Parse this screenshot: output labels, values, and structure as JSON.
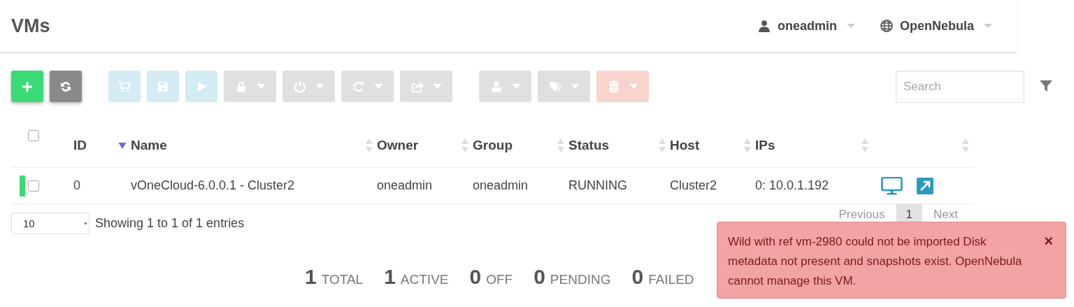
{
  "header": {
    "title": "VMs",
    "user": "oneadmin",
    "zone": "OpenNebula"
  },
  "toolbar": [
    {
      "kind": "create",
      "disabled": false,
      "dropdown": false
    },
    {
      "kind": "refresh",
      "disabled": false,
      "dropdown": false
    },
    {
      "kind": "info",
      "disabled": true,
      "dropdown": false
    },
    {
      "kind": "info",
      "disabled": true,
      "dropdown": false
    },
    {
      "kind": "info",
      "disabled": true,
      "dropdown": false
    },
    {
      "kind": "neutral",
      "disabled": true,
      "dropdown": true
    },
    {
      "kind": "neutral",
      "disabled": true,
      "dropdown": true
    },
    {
      "kind": "neutral",
      "disabled": true,
      "dropdown": true
    },
    {
      "kind": "neutral",
      "disabled": true,
      "dropdown": true
    },
    {
      "kind": "neutral",
      "disabled": true,
      "dropdown": true
    },
    {
      "kind": "neutral",
      "disabled": true,
      "dropdown": true
    },
    {
      "kind": "danger",
      "disabled": true,
      "dropdown": true
    }
  ],
  "search": {
    "placeholder": "Search"
  },
  "table": {
    "select_all": {
      "checked": false
    },
    "columns": [
      {
        "label": "ID",
        "sorted": true
      },
      {
        "label": "Name",
        "sorted": false
      },
      {
        "label": "Owner",
        "sorted": false
      },
      {
        "label": "Group",
        "sorted": false
      },
      {
        "label": "Status",
        "sorted": false
      },
      {
        "label": "Host",
        "sorted": false
      },
      {
        "label": "IPs",
        "sorted": false
      },
      {
        "sorted": false
      }
    ],
    "rows": [
      {
        "color": "#3adb76",
        "checked": false,
        "id": "0",
        "name": "vOneCloud-6.0.0.1 - Cluster2",
        "owner": "oneadmin",
        "group": "oneadmin",
        "status": "RUNNING",
        "host": "Cluster2",
        "ips": "0: 10.0.1.192"
      }
    ]
  },
  "page_size": "10",
  "info": "Showing 1 to 1 of 1 entries",
  "pagination": [
    {
      "label": "Previous",
      "selected": false
    },
    {
      "label": "1",
      "selected": true
    },
    {
      "label": "Next",
      "selected": false
    }
  ],
  "stats": [
    {
      "count": "1",
      "label": "TOTAL"
    },
    {
      "count": "1",
      "label": "ACTIVE"
    },
    {
      "count": "0",
      "label": "OFF"
    },
    {
      "count": "0",
      "label": "PENDING"
    },
    {
      "count": "0",
      "label": "FAILED"
    }
  ],
  "notification": {
    "message": "Wild with ref vm-2980 could not be imported Disk metadata not present and snapshots exist. OpenNebula cannot manage this VM.",
    "close": "×"
  }
}
